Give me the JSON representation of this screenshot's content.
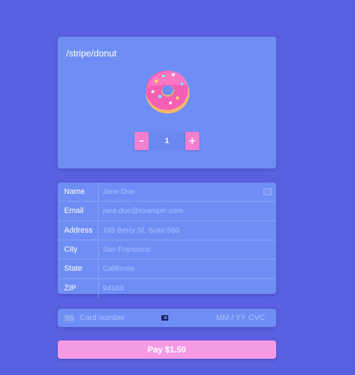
{
  "product": {
    "title": "/stripe/donut",
    "image_icon": "donut-icon",
    "quantity": {
      "decrement_label": "–",
      "value": "1",
      "increment_label": "+"
    }
  },
  "billing": {
    "rows": [
      {
        "label": "Name",
        "placeholder": "Jane Doe"
      },
      {
        "label": "Email",
        "placeholder": "jane.doe@example.com"
      },
      {
        "label": "Address",
        "placeholder": "185 Berry St. Suite 550"
      },
      {
        "label": "City",
        "placeholder": "San Francisco"
      },
      {
        "label": "State",
        "placeholder": "California"
      },
      {
        "label": "ZIP",
        "placeholder": "94103"
      }
    ]
  },
  "card": {
    "number_placeholder": "Card number",
    "expiry_placeholder": "MM / YY",
    "cvc_placeholder": "CVC"
  },
  "pay": {
    "label": "Pay $1.50"
  },
  "colors": {
    "background": "#5a61e1",
    "card": "#6f8ef5",
    "accent_pink": "#f37fd0",
    "placeholder": "#a9c0ff"
  }
}
